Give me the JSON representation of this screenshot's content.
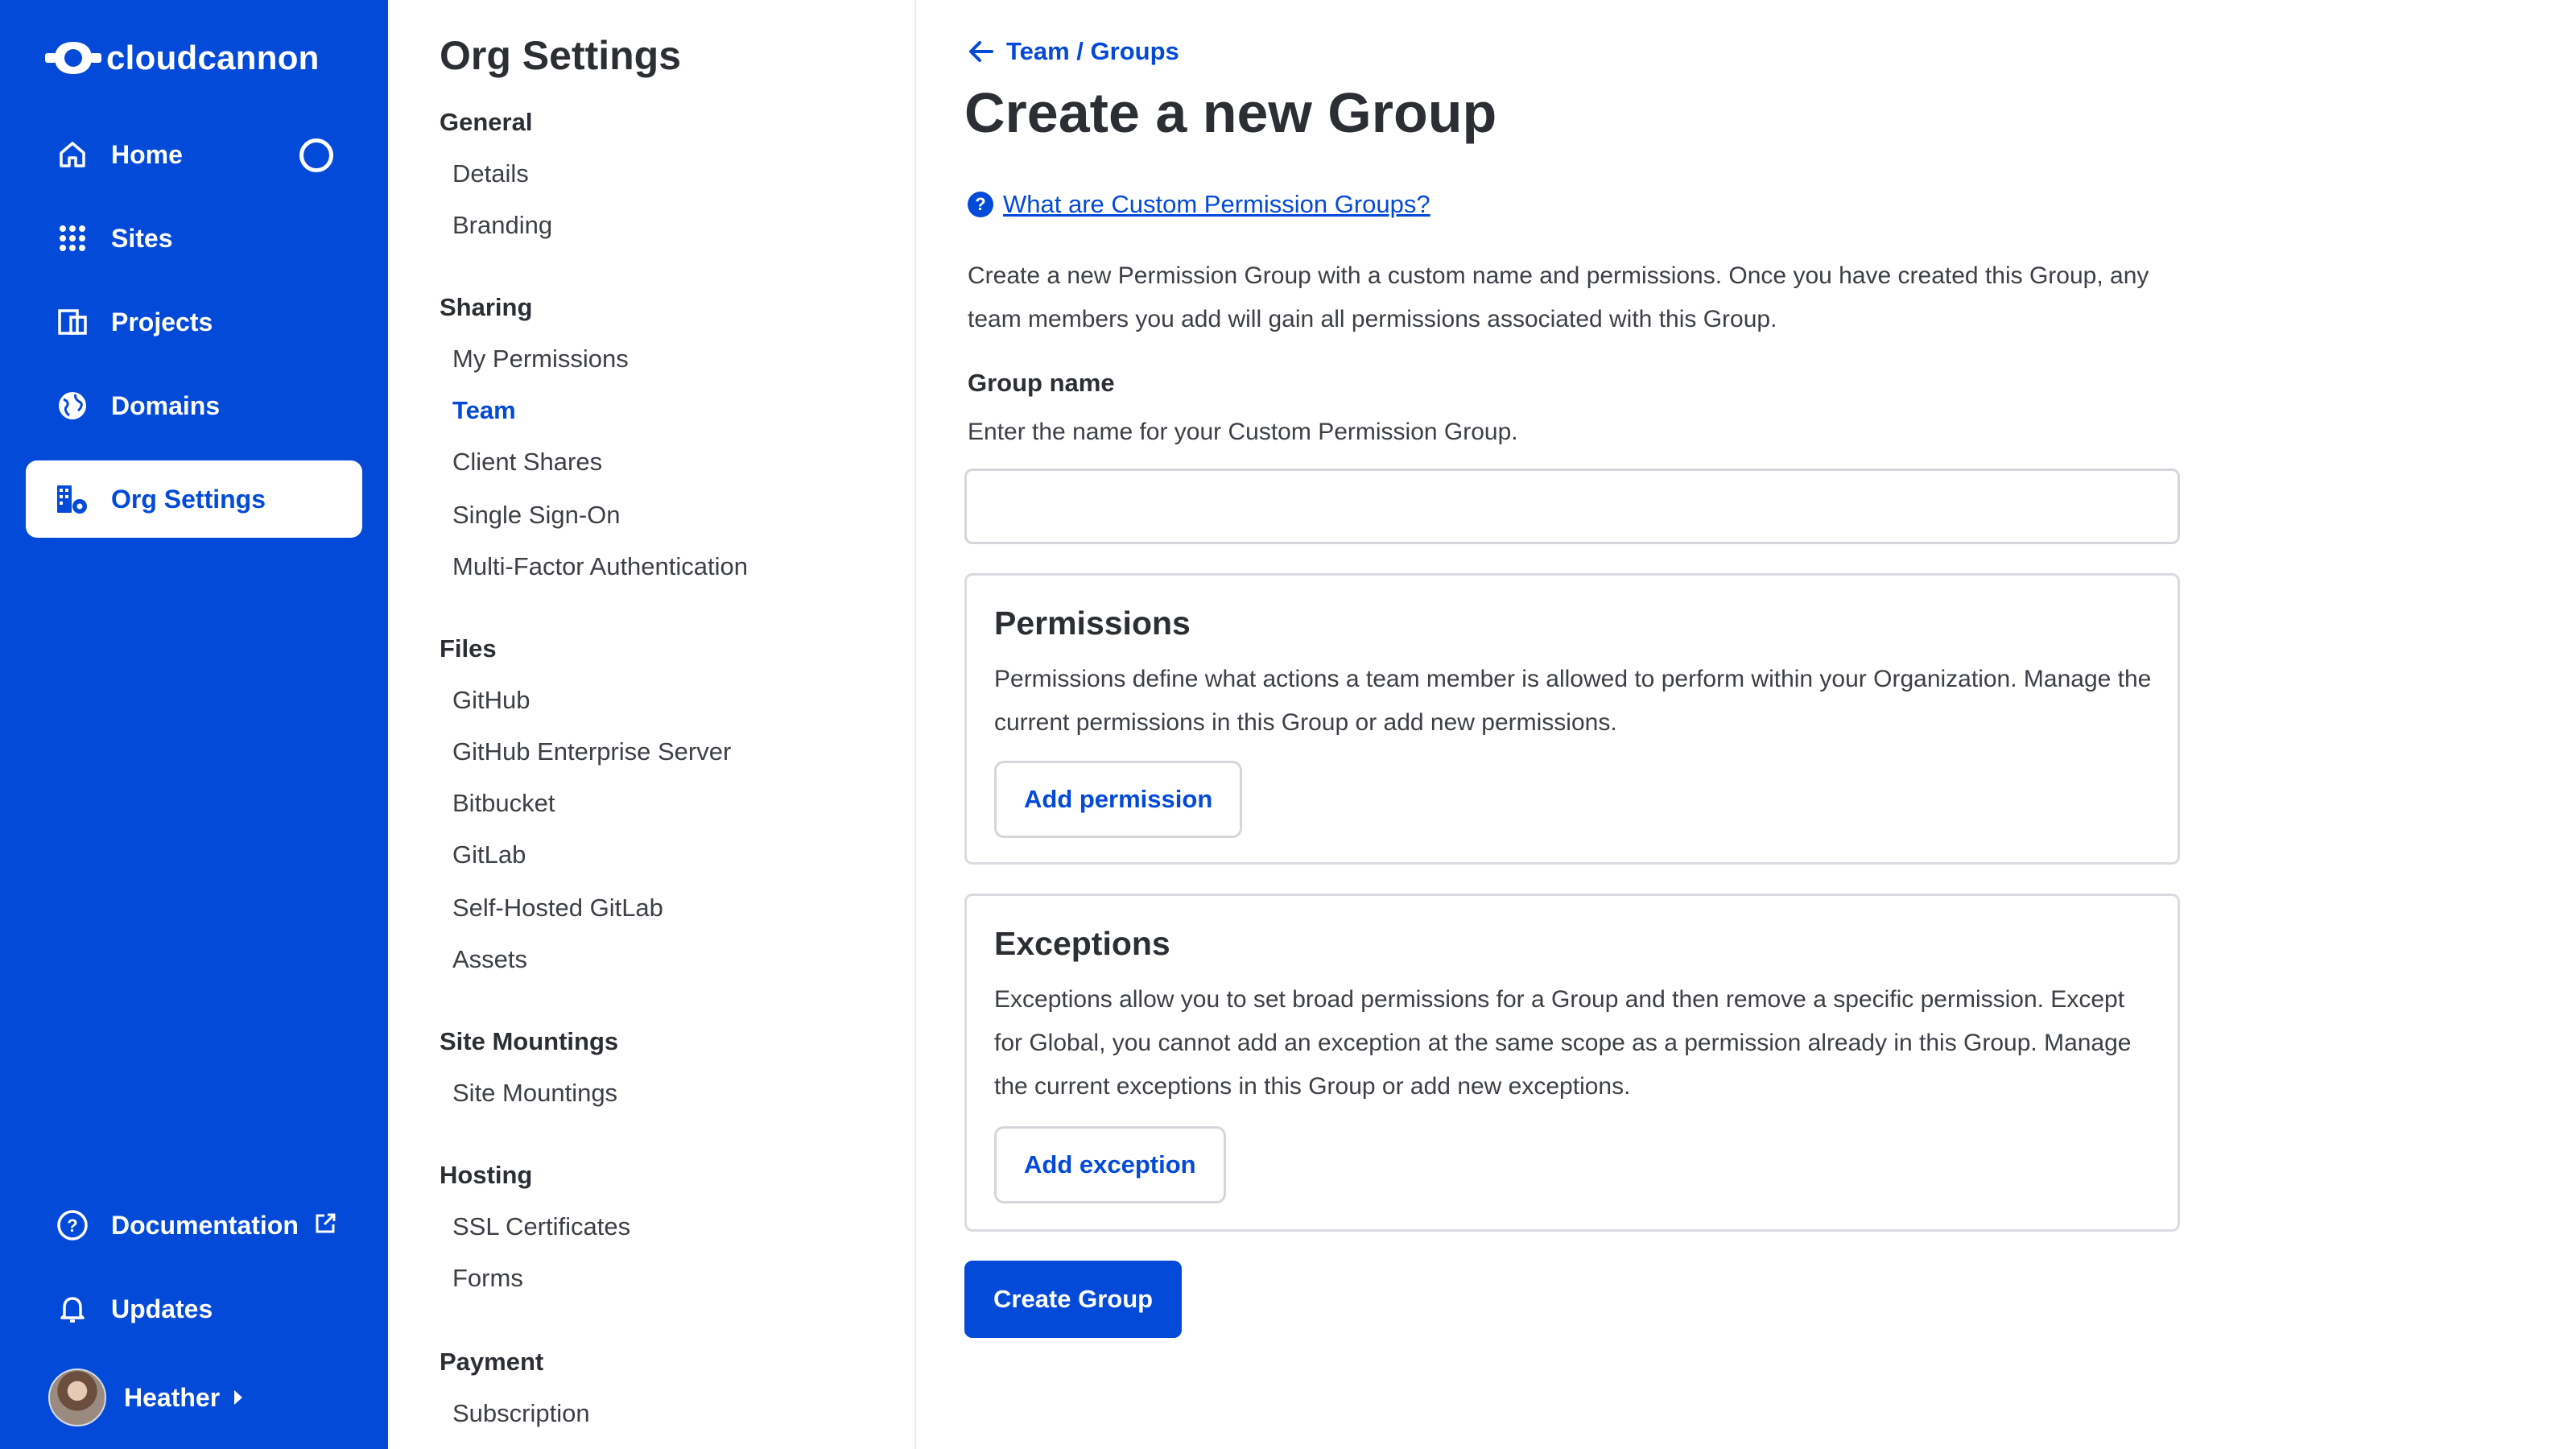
{
  "brand": {
    "name": "cloudcannon",
    "logo_icon": "cloudcannon-logo-icon"
  },
  "nav": {
    "items": [
      {
        "label": "Home",
        "icon": "home-icon"
      },
      {
        "label": "Sites",
        "icon": "grid-icon"
      },
      {
        "label": "Projects",
        "icon": "projects-icon"
      },
      {
        "label": "Domains",
        "icon": "globe-icon"
      },
      {
        "label": "Org Settings",
        "icon": "org-settings-icon",
        "active": true
      }
    ],
    "footer": [
      {
        "label": "Documentation",
        "icon": "help-circle-icon",
        "external_icon": "external-link-icon"
      },
      {
        "label": "Updates",
        "icon": "bell-icon"
      }
    ],
    "user": {
      "name": "Heather"
    }
  },
  "submenu": {
    "title": "Org Settings",
    "sections": [
      {
        "heading": "General",
        "items": [
          "Details",
          "Branding"
        ]
      },
      {
        "heading": "Sharing",
        "items": [
          "My Permissions",
          "Team",
          "Client Shares",
          "Single Sign-On",
          "Multi-Factor Authentication"
        ],
        "active": "Team"
      },
      {
        "heading": "Files",
        "items": [
          "GitHub",
          "GitHub Enterprise Server",
          "Bitbucket",
          "GitLab",
          "Self-Hosted GitLab",
          "Assets"
        ]
      },
      {
        "heading": "Site Mountings",
        "items": [
          "Site Mountings"
        ]
      },
      {
        "heading": "Hosting",
        "items": [
          "SSL Certificates",
          "Forms"
        ]
      },
      {
        "heading": "Payment",
        "items": [
          "Subscription"
        ]
      }
    ]
  },
  "main": {
    "breadcrumb": "Team / Groups",
    "title": "Create a new Group",
    "help_link": "What are Custom Permission Groups?",
    "intro": "Create a new Permission Group with a custom name and permissions. Once you have created this Group, any team members you add will gain all permissions associated with this Group.",
    "group_name": {
      "label": "Group name",
      "help": "Enter the name for your Custom Permission Group.",
      "value": "",
      "placeholder": ""
    },
    "permissions": {
      "title": "Permissions",
      "text": "Permissions define what actions a team member is allowed to perform within your Organization. Manage the current permissions in this Group or add new permissions.",
      "button": "Add permission"
    },
    "exceptions": {
      "title": "Exceptions",
      "text": "Exceptions allow you to set broad permissions for a Group and then remove a specific permission. Except for Global, you cannot add an exception at the same scope as a permission already in this Group. Manage the current exceptions in this Group or add new exceptions.",
      "button": "Add exception"
    },
    "submit": "Create Group"
  },
  "colors": {
    "brand_blue": "#034ad8",
    "text": "#2b2f33",
    "border": "#d4d6db"
  }
}
